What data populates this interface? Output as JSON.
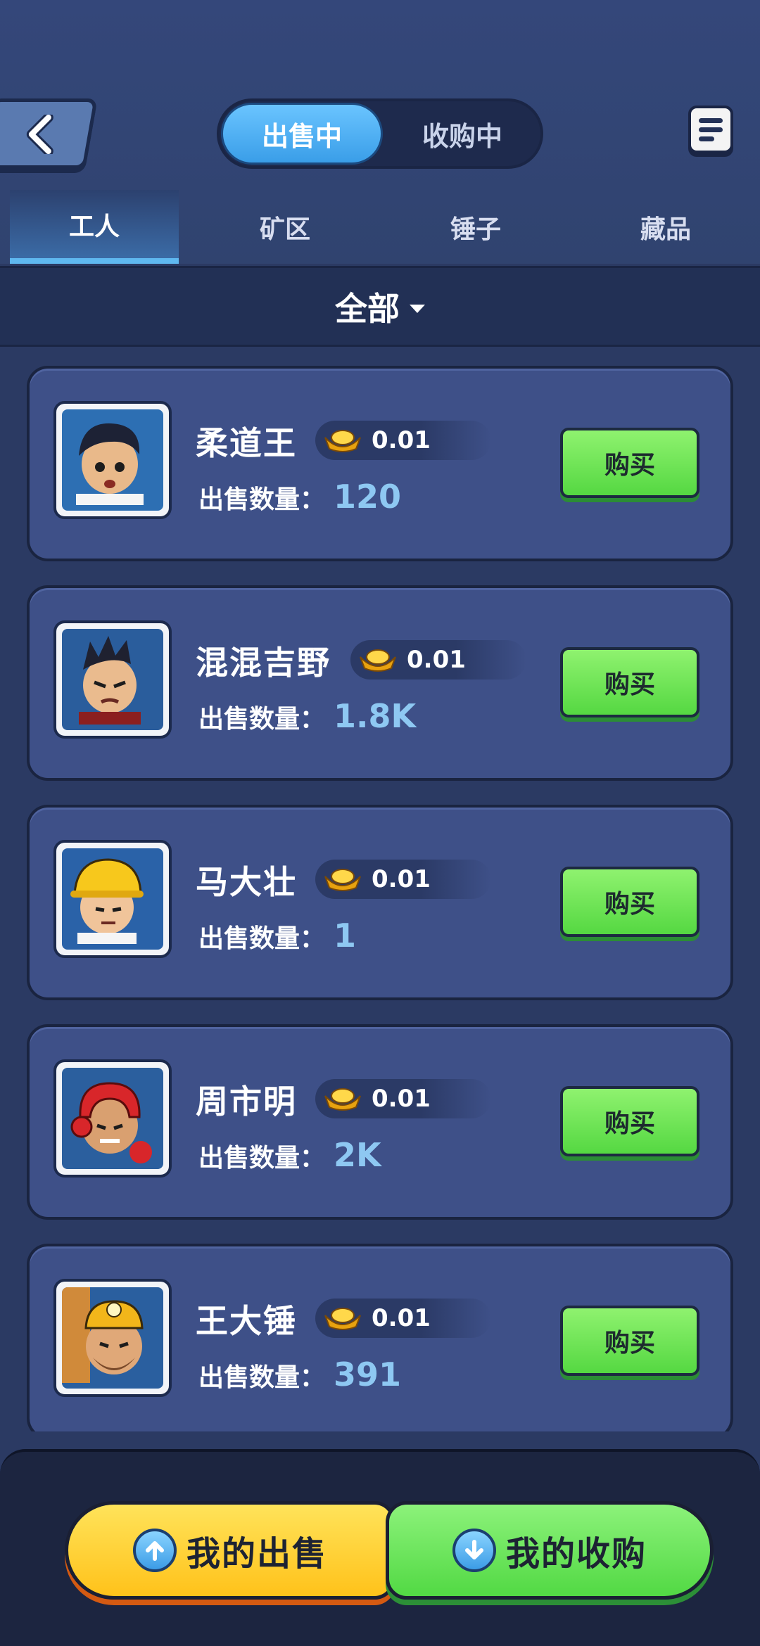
{
  "header": {
    "segment_on": "出售中",
    "segment_off": "收购中"
  },
  "tabs": [
    {
      "label": "工人",
      "active": true
    },
    {
      "label": "矿区",
      "active": false
    },
    {
      "label": "锤子",
      "active": false
    },
    {
      "label": "藏品",
      "active": false
    }
  ],
  "filter": {
    "label": "全部"
  },
  "qty_label": "出售数量：",
  "buy_label": "购买",
  "items": [
    {
      "name": "柔道王",
      "price": "0.01",
      "qty": "120",
      "avatar": "judo-worker-avatar"
    },
    {
      "name": "混混吉野",
      "price": "0.01",
      "qty": "1.8K",
      "avatar": "thug-worker-avatar"
    },
    {
      "name": "马大壮",
      "price": "0.01",
      "qty": "1",
      "avatar": "helmet-worker-avatar"
    },
    {
      "name": "周市明",
      "price": "0.01",
      "qty": "2K",
      "avatar": "boxer-worker-avatar"
    },
    {
      "name": "王大锤",
      "price": "0.01",
      "qty": "391",
      "avatar": "miner-worker-avatar"
    }
  ],
  "bottom": {
    "sell_label": "我的出售",
    "buy_label": "我的收购"
  },
  "colors": {
    "background": "#2b3a63",
    "card": "#3e5088",
    "buy_green": "#55d842",
    "accent_blue": "#3a9ee8",
    "gold": "#ffc21a",
    "qty_blue": "#8ec8f2"
  }
}
